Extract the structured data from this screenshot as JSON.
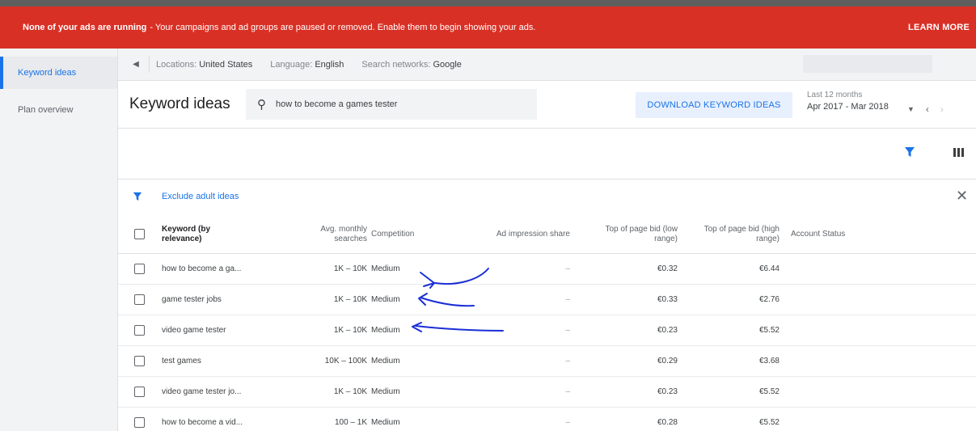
{
  "alert": {
    "bold_text": "None of your ads are running",
    "message": "- Your campaigns and ad groups are paused or removed. Enable them to begin showing your ads.",
    "action": "LEARN MORE"
  },
  "sidebar": {
    "items": [
      {
        "label": "Keyword ideas"
      },
      {
        "label": "Plan overview"
      }
    ]
  },
  "filters": {
    "locations_label": "Locations:",
    "locations_value": "United States",
    "language_label": "Language:",
    "language_value": "English",
    "networks_label": "Search networks:",
    "networks_value": "Google"
  },
  "header": {
    "title": "Keyword ideas",
    "search_value": "how to become a games tester",
    "download_label": "DOWNLOAD KEYWORD IDEAS",
    "date_label": "Last 12 months",
    "date_value": "Apr 2017 - Mar 2018"
  },
  "exclude": {
    "label": "Exclude adult ideas"
  },
  "table": {
    "headers": {
      "keyword": "Keyword (by relevance)",
      "searches": "Avg. monthly searches",
      "competition": "Competition",
      "impression": "Ad impression share",
      "bid_low": "Top of page bid (low range)",
      "bid_high": "Top of page bid (high range)",
      "status": "Account Status"
    },
    "rows": [
      {
        "keyword": "how to become a ga...",
        "searches": "1K – 10K",
        "competition": "Medium",
        "impression": "–",
        "bid_low": "€0.32",
        "bid_high": "€6.44"
      },
      {
        "keyword": "game tester jobs",
        "searches": "1K – 10K",
        "competition": "Medium",
        "impression": "–",
        "bid_low": "€0.33",
        "bid_high": "€2.76"
      },
      {
        "keyword": "video game tester",
        "searches": "1K – 10K",
        "competition": "Medium",
        "impression": "–",
        "bid_low": "€0.23",
        "bid_high": "€5.52"
      },
      {
        "keyword": "test games",
        "searches": "10K – 100K",
        "competition": "Medium",
        "impression": "–",
        "bid_low": "€0.29",
        "bid_high": "€3.68"
      },
      {
        "keyword": "video game tester jo...",
        "searches": "1K – 10K",
        "competition": "Medium",
        "impression": "–",
        "bid_low": "€0.23",
        "bid_high": "€5.52"
      },
      {
        "keyword": "how to become a vid...",
        "searches": "100 – 1K",
        "competition": "Medium",
        "impression": "–",
        "bid_low": "€0.28",
        "bid_high": "€5.52"
      }
    ]
  },
  "colors": {
    "alert_bg": "#d93025",
    "accent": "#1a73e8",
    "annotation_ink": "#1a2fd6"
  }
}
